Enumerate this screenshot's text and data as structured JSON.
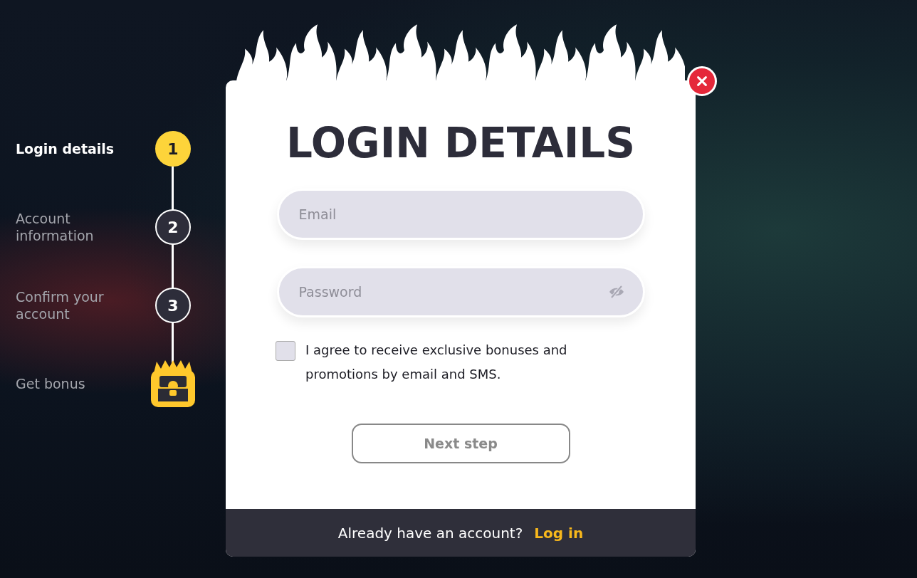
{
  "steps": [
    {
      "kind": "number",
      "label": "Login details",
      "number": "1",
      "selected": true
    },
    {
      "kind": "number",
      "label": "Account information",
      "number": "2",
      "selected": false
    },
    {
      "kind": "number",
      "label": "Confirm your account",
      "number": "3",
      "selected": false
    },
    {
      "kind": "bonus",
      "label": "Get bonus",
      "selected": false
    }
  ],
  "dialog": {
    "title": "LOGIN DETAILS",
    "fields": [
      {
        "kind": "text",
        "placeholder": "Email"
      },
      {
        "kind": "password",
        "placeholder": "Password"
      }
    ],
    "consent": {
      "checked": false,
      "text": "I agree to receive exclusive bonuses and promotions by email and SMS."
    },
    "next_button": {
      "label": "Next step",
      "disabled": true
    },
    "footer": {
      "text": "Already have an account?",
      "link": "Log in"
    }
  }
}
